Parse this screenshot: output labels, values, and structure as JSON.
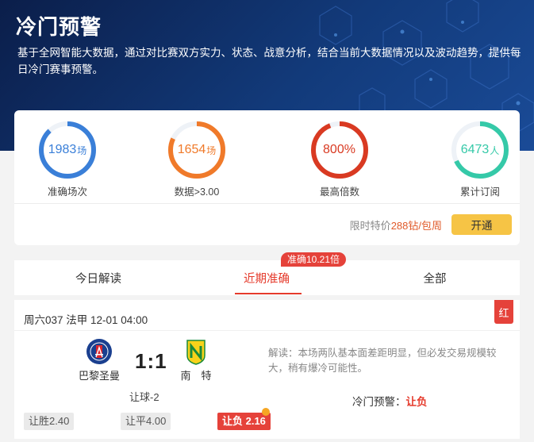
{
  "hero": {
    "title": "冷门预警",
    "description": "基于全网智能大数据，通过对比赛双方实力、状态、战意分析，结合当前大数据情况以及波动趋势，提供每日冷门赛事预警。"
  },
  "stats": [
    {
      "value": "1983",
      "unit": "场",
      "label": "准确场次",
      "color": "#3a7fd8",
      "fill": 0.88
    },
    {
      "value": "1654",
      "unit": "场",
      "label": "数据>3.00",
      "color": "#f07a2a",
      "fill": 0.82
    },
    {
      "value": "800%",
      "unit": "",
      "label": "最高倍数",
      "color": "#d93a22",
      "fill": 0.94
    },
    {
      "value": "6473",
      "unit": "人",
      "label": "累计订阅",
      "color": "#35c9a8",
      "fill": 0.68
    }
  ],
  "subscribe": {
    "price_prefix": "限时特价",
    "price_value": "288钻/包周",
    "button_label": "开通"
  },
  "tabs": {
    "badge": "准确10.21倍",
    "items": [
      {
        "label": "今日解读"
      },
      {
        "label": "近期准确"
      },
      {
        "label": "全部"
      }
    ]
  },
  "match": {
    "header": "周六037 法甲 12-01 04:00",
    "result_tag": "红",
    "home_team": "巴黎圣曼",
    "away_team": "南　特",
    "score": "1:1",
    "handicap": "让球-2",
    "analysis": "解读：本场两队基本面差距明显，但必发交易规模较大，稍有爆冷可能性。",
    "warning_label": "冷门预警：",
    "warning_value": "让负",
    "odds": [
      {
        "label": "让胜2.40"
      },
      {
        "label": "让平4.00"
      },
      {
        "label": "让负 2.16"
      }
    ]
  }
}
